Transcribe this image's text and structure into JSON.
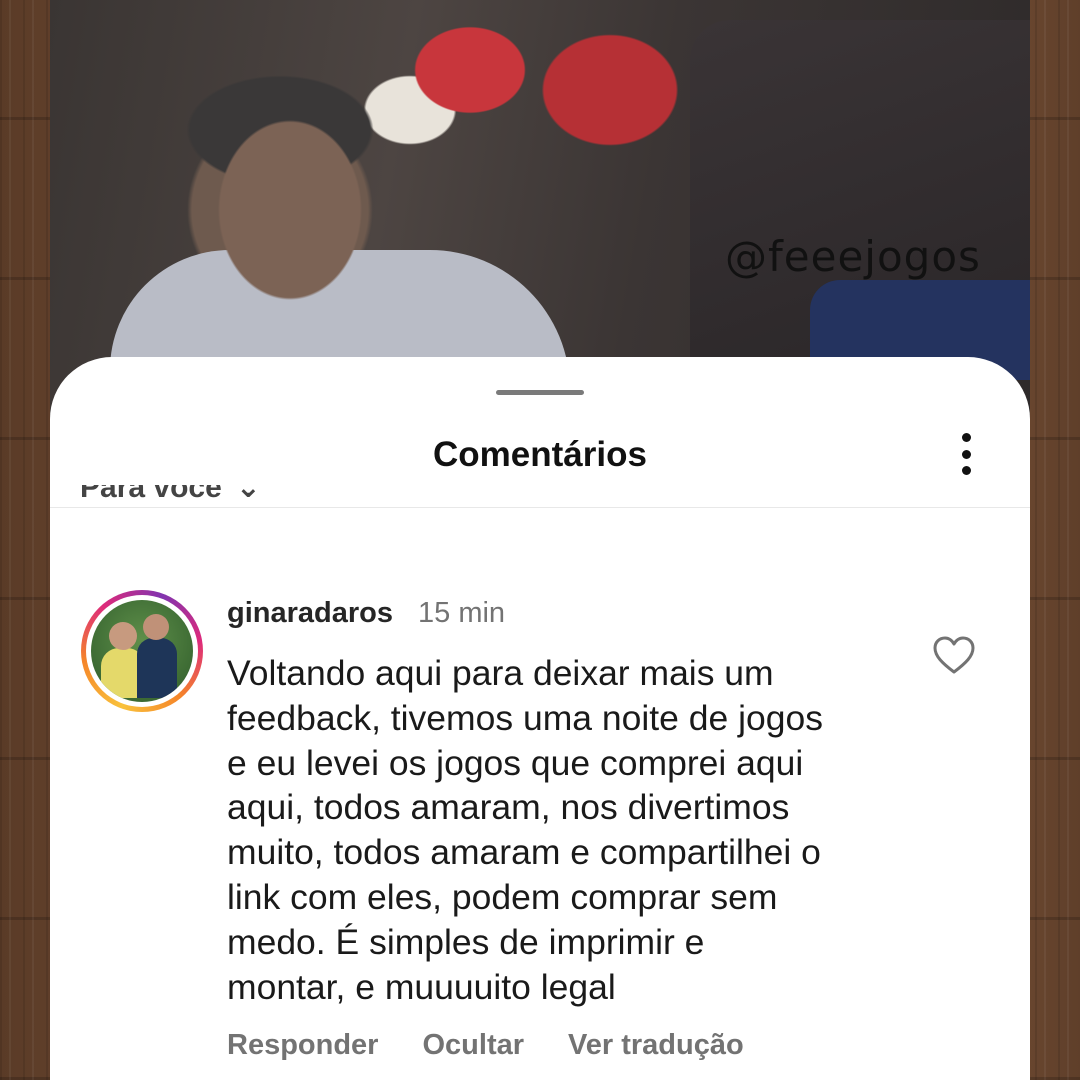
{
  "overlay": {
    "watermark": "@feeejogos"
  },
  "sheet": {
    "title": "Comentários",
    "sort_label": "Para você",
    "more_icon": "more-vertical-icon"
  },
  "comment": {
    "username": "ginaradaros",
    "time": "15 min",
    "text": "Voltando aqui para deixar mais um\nfeedback,  tivemos uma noite de jogos\ne eu levei os jogos que comprei aqui\naqui, todos amaram, nos divertimos\nmuito, todos amaram e compartilhei o\nlink com eles, podem comprar sem\nmedo. É simples  de imprimir e\nmontar, e muuuuito legal",
    "like_icon": "heart-outline-icon",
    "actions": {
      "reply": "Responder",
      "hide": "Ocultar",
      "translate": "Ver tradução"
    }
  }
}
